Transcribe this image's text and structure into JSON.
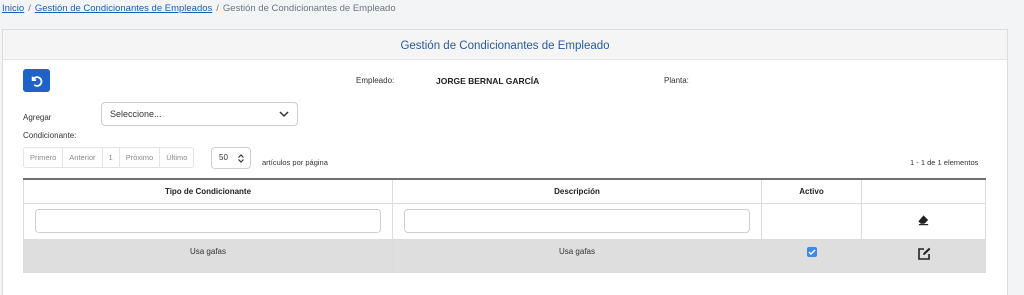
{
  "breadcrumb": {
    "home": "Inicio",
    "parent": "Gestión de Condicionantes de Empleados",
    "current": "Gestión de Condicionantes de Empleado",
    "separator": "/"
  },
  "panel": {
    "title": "Gestión de Condicionantes de Empleado"
  },
  "employee": {
    "label": "Empleado:",
    "name": "JORGE BERNAL GARCÍA",
    "plant_label": "Planta:"
  },
  "add_condition": {
    "label_line1": "Agregar",
    "label_line2": "Condicionante:",
    "select_value": "Seleccione..."
  },
  "pager": {
    "first": "Primero",
    "prev": "Anterior",
    "page": "1",
    "next": "Próximo",
    "last": "Último",
    "per_page_value": "50",
    "per_page_label": "artículos por página",
    "count_text": "1 - 1 de 1 elementos"
  },
  "table": {
    "headers": [
      "Tipo de Condicionante",
      "Descripción",
      "Activo",
      ""
    ],
    "rows": [
      {
        "tipo": "Usa gafas",
        "descripcion": "Usa gafas",
        "activo": true
      }
    ]
  },
  "icons": {
    "back": "undo-icon",
    "clear": "eraser-icon",
    "edit": "edit-icon",
    "checkbox": "checkbox-checked-icon"
  },
  "colors": {
    "accent": "#1f63c9",
    "title": "#2a5a9a",
    "row": "#dedede"
  }
}
